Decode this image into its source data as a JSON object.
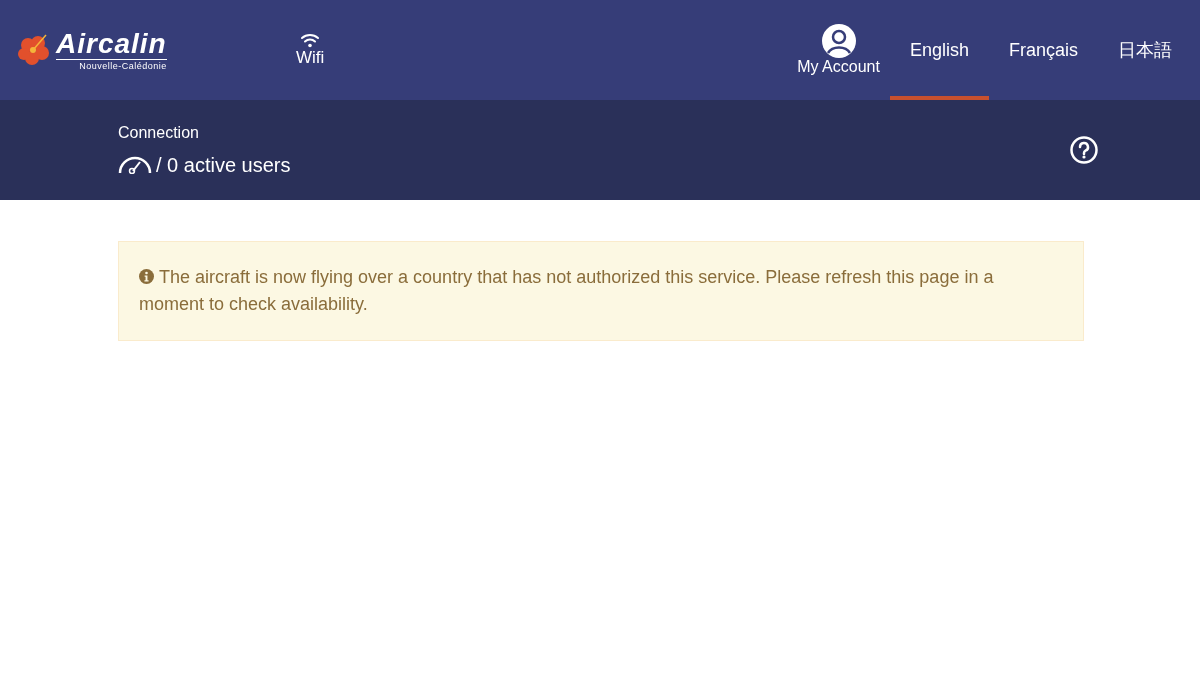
{
  "header": {
    "logo": {
      "name": "Aircalin",
      "tagline": "Nouvelle-Calédonie"
    },
    "wifi": {
      "label": "Wifi"
    },
    "account": {
      "label": "My Account"
    },
    "languages": [
      {
        "label": "English",
        "selected": true
      },
      {
        "label": "Français",
        "selected": false
      },
      {
        "label": "日本語",
        "selected": false
      }
    ]
  },
  "connection": {
    "title": "Connection",
    "status": "/ 0 active users"
  },
  "alert": {
    "message": "The aircraft is now flying over a country that has not authorized this service. Please refresh this page in a moment to check availability."
  }
}
